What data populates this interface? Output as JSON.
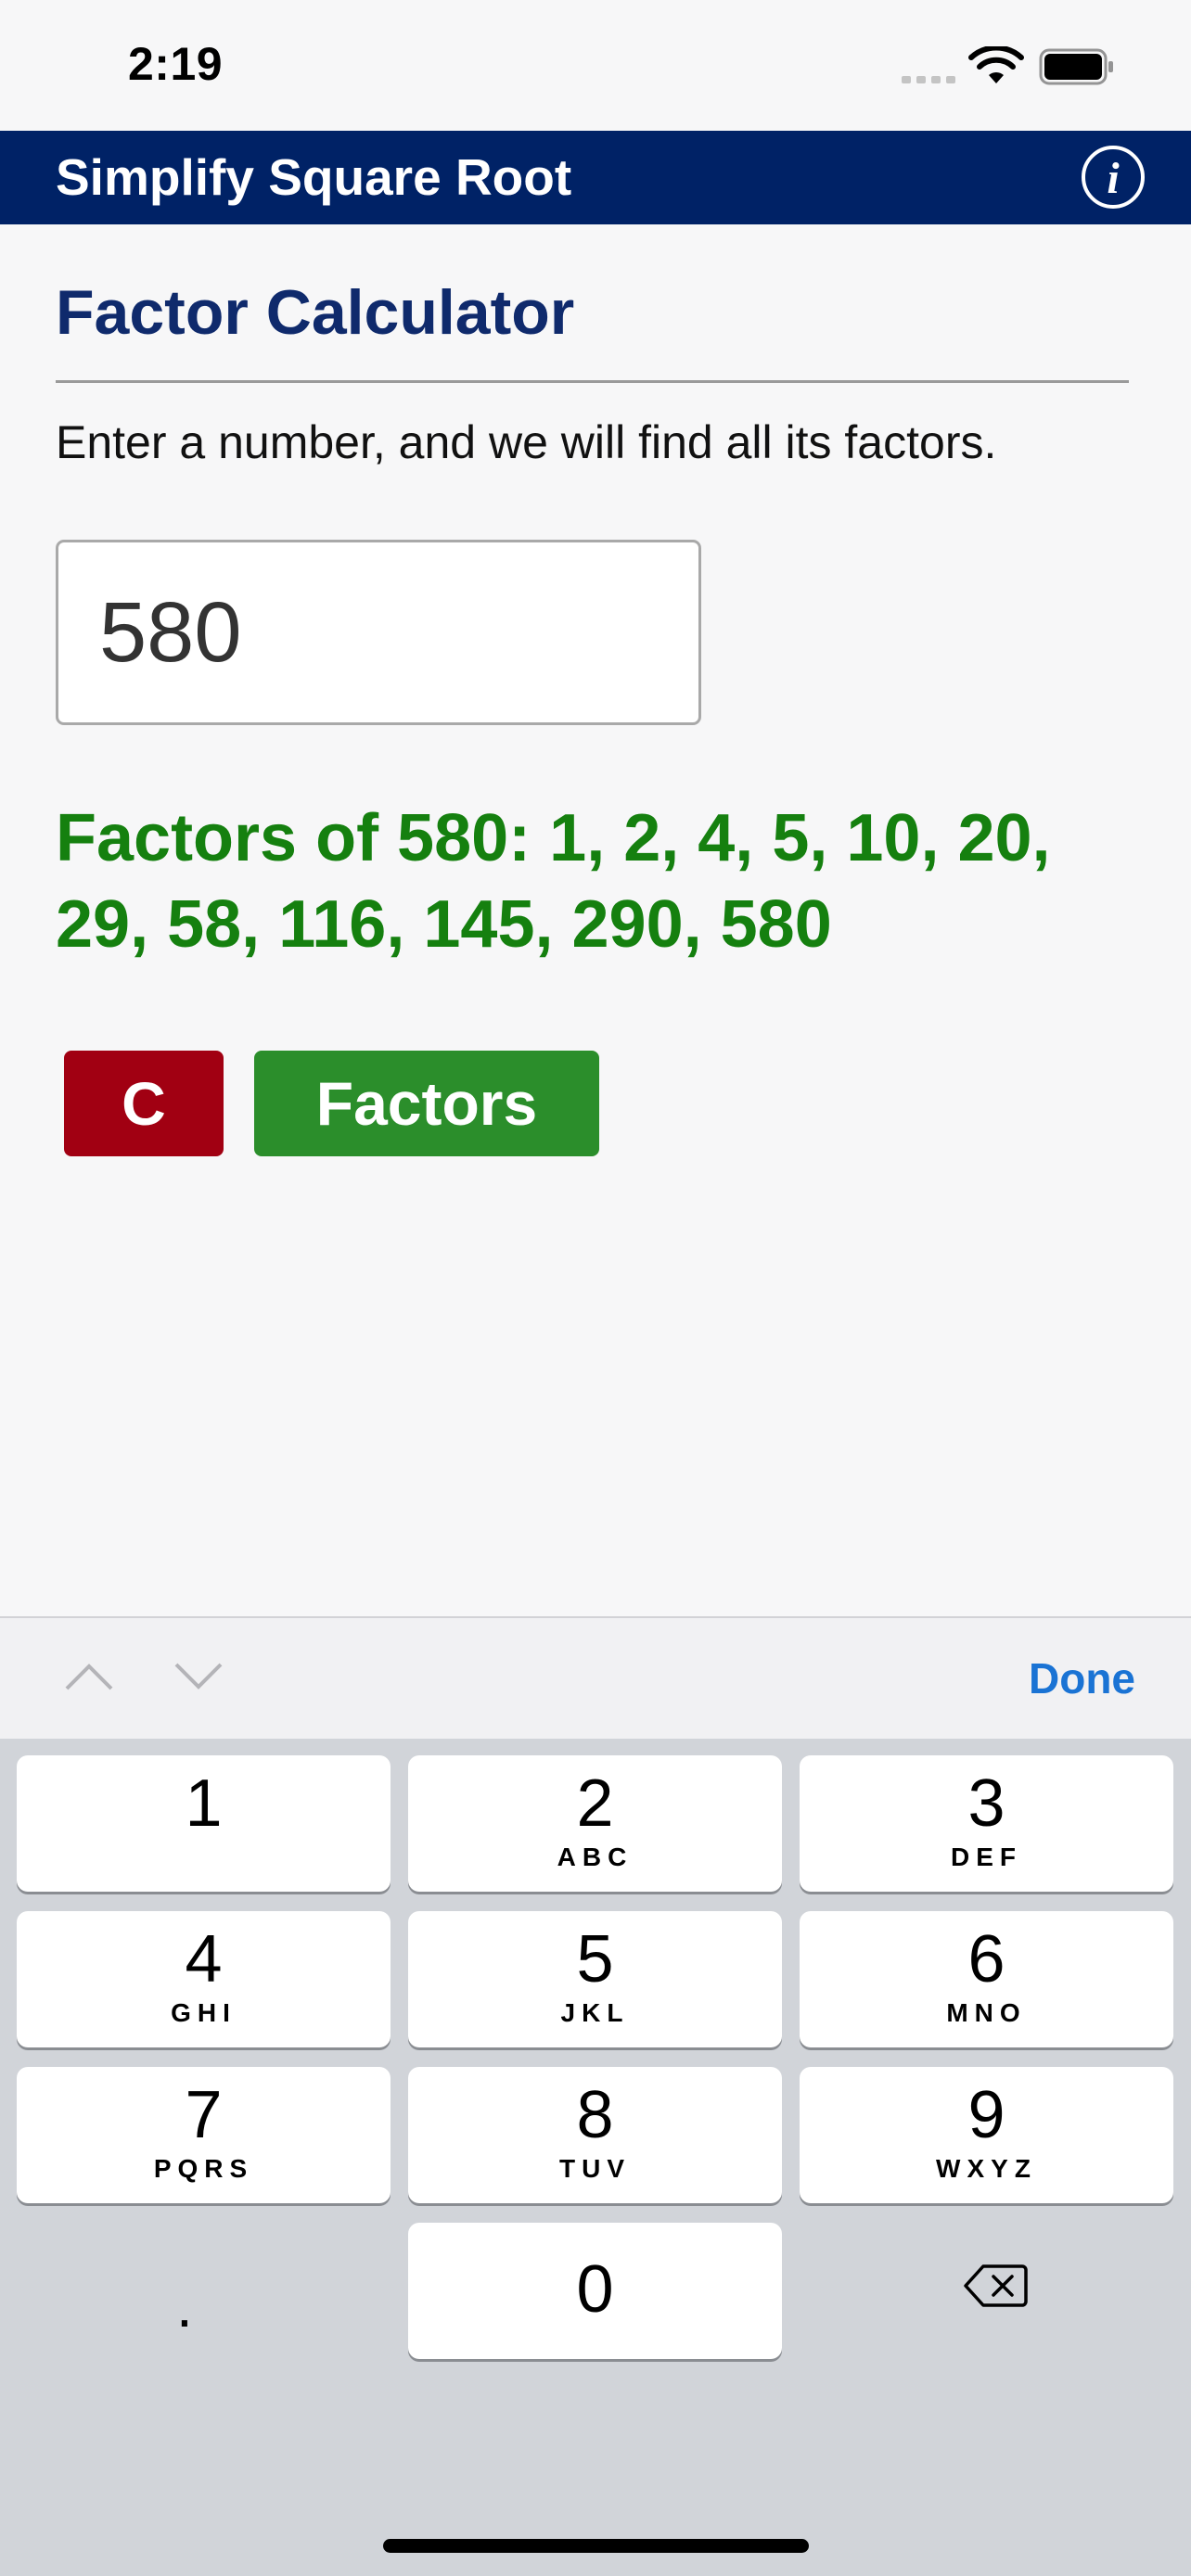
{
  "status_bar": {
    "time": "2:19"
  },
  "nav": {
    "title": "Simplify Square Root",
    "info_label": "i"
  },
  "page": {
    "heading": "Factor Calculator",
    "description": "Enter a number, and we will find all its factors.",
    "input_value": "580",
    "result": "Factors of 580: 1, 2, 4, 5, 10, 20, 29, 58, 116, 145, 290, 580"
  },
  "buttons": {
    "clear": "C",
    "factors": "Factors"
  },
  "keyboard": {
    "done": "Done",
    "keys": [
      {
        "digit": "1",
        "letters": ""
      },
      {
        "digit": "2",
        "letters": "ABC"
      },
      {
        "digit": "3",
        "letters": "DEF"
      },
      {
        "digit": "4",
        "letters": "GHI"
      },
      {
        "digit": "5",
        "letters": "JKL"
      },
      {
        "digit": "6",
        "letters": "MNO"
      },
      {
        "digit": "7",
        "letters": "PQRS"
      },
      {
        "digit": "8",
        "letters": "TUV"
      },
      {
        "digit": "9",
        "letters": "WXYZ"
      },
      {
        "digit": "0",
        "letters": ""
      }
    ],
    "decimal": "."
  }
}
